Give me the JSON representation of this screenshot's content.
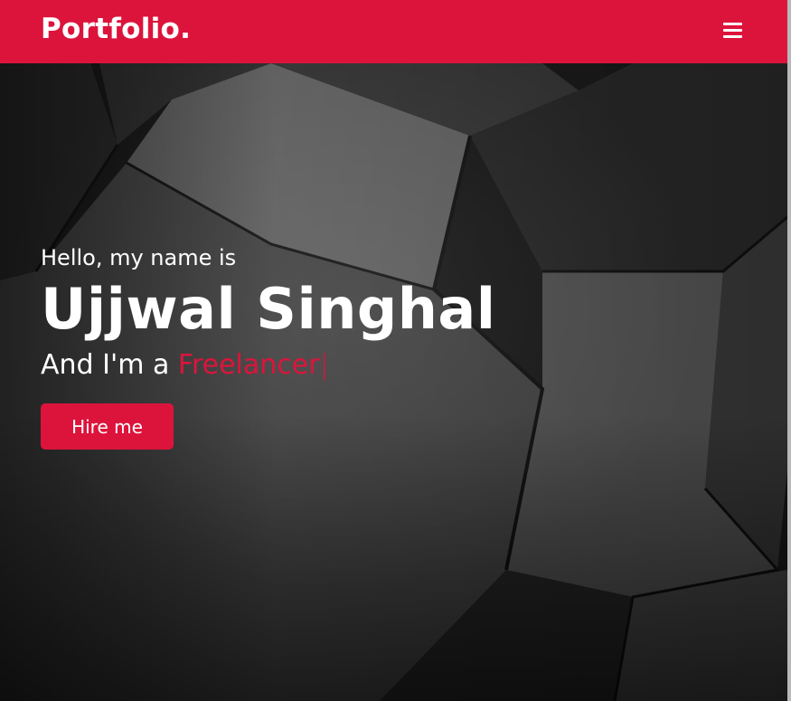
{
  "navbar": {
    "logo": "Portfolio.",
    "menu_icon": "hamburger-menu-icon",
    "background": "#dc143c"
  },
  "hero": {
    "greeting": "Hello, my name is",
    "name": "Ujjwal Singhal",
    "role_prefix": "And I'm a ",
    "role_typed": "Freelancer",
    "typing_cursor": "|",
    "hire_button": "Hire me",
    "accent": "#dc143c"
  }
}
